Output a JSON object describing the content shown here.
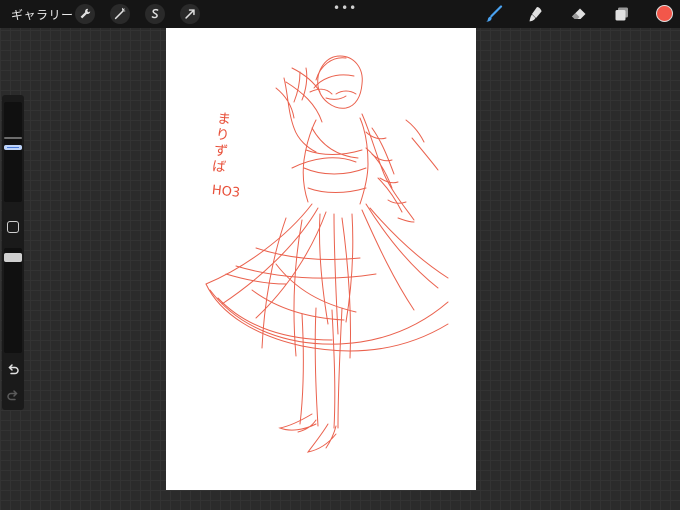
{
  "topbar": {
    "gallery_label": "ギャラリー",
    "more_label": "•••",
    "tools_left": [
      "wrench-icon",
      "magic-wand-icon",
      "selection-s-icon",
      "transform-arrow-icon"
    ],
    "tools_right": [
      "brush-icon",
      "smudge-icon",
      "eraser-icon",
      "layers-icon"
    ],
    "active_color": "#f2574a",
    "active_tool_color": "#4aa3f2"
  },
  "sidebar": {
    "size_slider": {
      "value": 0.55
    },
    "opacity_slider": {
      "value": 0.1
    },
    "undo_icon": "undo-icon",
    "redo_icon": "redo-icon"
  },
  "canvas": {
    "background": "#ffffff",
    "stroke_color": "#e8503a",
    "note_lines": [
      "まりずば",
      "HO3"
    ]
  }
}
